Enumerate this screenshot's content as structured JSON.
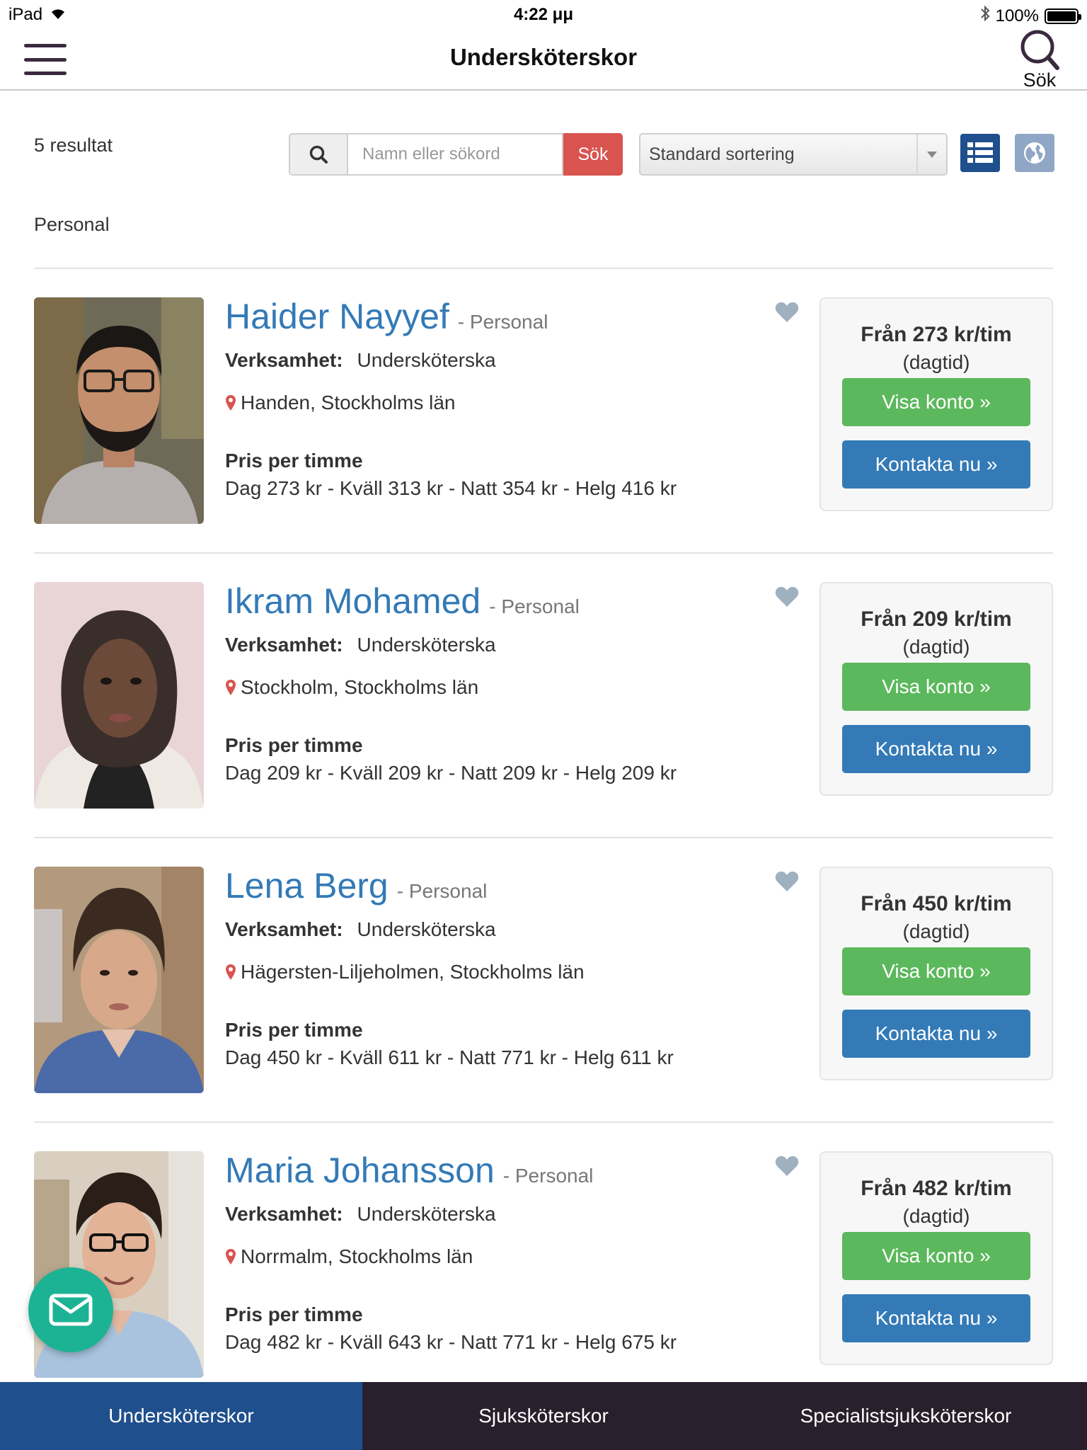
{
  "status_bar": {
    "device": "iPad",
    "time": "4:22 μμ",
    "battery": "100%"
  },
  "header": {
    "title": "Undersköterskor",
    "search_label": "Sök"
  },
  "toolbar": {
    "results_count": "5 resultat",
    "search_placeholder": "Namn eller sökord",
    "search_button": "Sök",
    "sort_selected": "Standard sortering"
  },
  "section_label": "Personal",
  "labels": {
    "role_tag": "- Personal",
    "business_key": "Verksamhet:",
    "price_title": "Pris per timme",
    "daytime": "(dagtid)",
    "view_account": "Visa konto »",
    "contact": "Kontakta nu »"
  },
  "people": [
    {
      "name": "Haider Nayyef",
      "business": "Undersköterska",
      "location": "Handen, Stockholms län",
      "prices": "Dag 273 kr - Kväll 313 kr - Natt 354 kr - Helg 416 kr",
      "from_price": "Från 273 kr/tim"
    },
    {
      "name": "Ikram Mohamed",
      "business": "Undersköterska",
      "location": "Stockholm, Stockholms län",
      "prices": "Dag 209 kr - Kväll 209 kr - Natt 209 kr - Helg 209 kr",
      "from_price": "Från 209 kr/tim"
    },
    {
      "name": "Lena Berg",
      "business": "Undersköterska",
      "location": "Hägersten-Liljeholmen, Stockholms län",
      "prices": "Dag 450 kr - Kväll 611 kr - Natt 771 kr - Helg 611 kr",
      "from_price": "Från 450 kr/tim"
    },
    {
      "name": "Maria Johansson",
      "business": "Undersköterska",
      "location": "Norrmalm, Stockholms län",
      "prices": "Dag 482 kr - Kväll 643 kr - Natt 771 kr - Helg 675 kr",
      "from_price": "Från 482 kr/tim"
    }
  ],
  "tabs": [
    {
      "label": "Undersköterskor",
      "active": true
    },
    {
      "label": "Sjuksköterskor",
      "active": false
    },
    {
      "label": "Specialistsjuksköterskor",
      "active": false
    }
  ],
  "colors": {
    "link_blue": "#337ab7",
    "green_button": "#5cb85c",
    "red_button": "#d9534f",
    "active_tab": "#1f4f8c",
    "tab_bar": "#2a1f2d",
    "mail_fab": "#1bb394"
  },
  "icons": {
    "menu": "hamburger-icon",
    "search": "search-icon",
    "list_view": "list-icon",
    "map_view": "globe-icon",
    "favorite": "heart-icon",
    "location": "map-pin-icon",
    "mail": "mail-icon"
  }
}
